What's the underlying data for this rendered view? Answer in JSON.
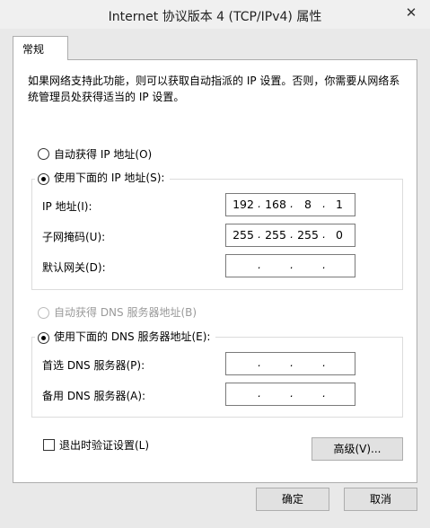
{
  "window": {
    "title": "Internet 协议版本 4 (TCP/IPv4) 属性",
    "close_glyph": "✕"
  },
  "tab": {
    "label": "常规"
  },
  "description": "如果网络支持此功能，则可以获取自动指派的 IP 设置。否则，你需要从网络系统管理员处获得适当的 IP 设置。",
  "ip": {
    "auto_label": "自动获得 IP 地址(O)",
    "manual_label": "使用下面的 IP 地址(S):",
    "address_label": "IP 地址(I):",
    "address": [
      "192",
      "168",
      "8",
      "1"
    ],
    "subnet_label": "子网掩码(U):",
    "subnet": [
      "255",
      "255",
      "255",
      "0"
    ],
    "gateway_label": "默认网关(D):",
    "gateway": [
      "",
      "",
      "",
      ""
    ]
  },
  "dns": {
    "auto_label": "自动获得 DNS 服务器地址(B)",
    "manual_label": "使用下面的 DNS 服务器地址(E):",
    "preferred_label": "首选 DNS 服务器(P):",
    "preferred": [
      "",
      "",
      "",
      ""
    ],
    "alternate_label": "备用 DNS 服务器(A):",
    "alternate": [
      "",
      "",
      "",
      ""
    ]
  },
  "validate_label": "退出时验证设置(L)",
  "advanced_label": "高级(V)...",
  "ok_label": "确定",
  "cancel_label": "取消"
}
